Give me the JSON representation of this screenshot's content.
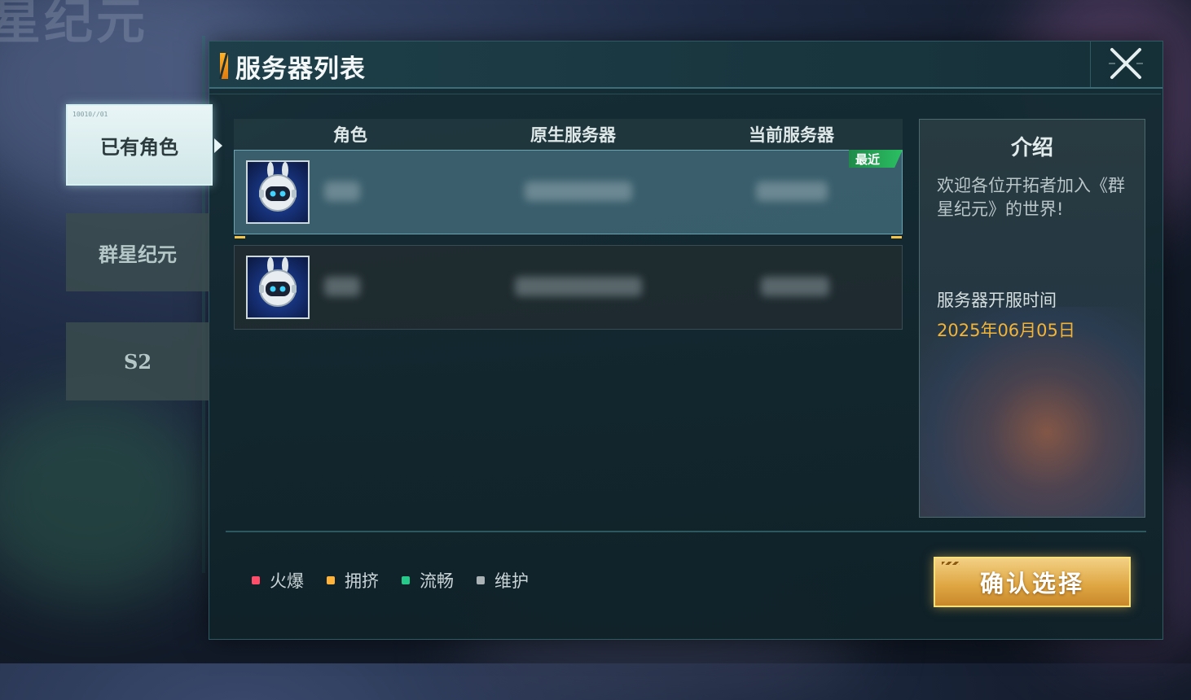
{
  "window": {
    "title": "服务器列表",
    "close_icon": "close-x-icon"
  },
  "tabs": [
    {
      "label": "已有角色",
      "tag": "10010//01",
      "active": true
    },
    {
      "label": "群星纪元",
      "active": false
    },
    {
      "label": "S2",
      "active": false
    }
  ],
  "table": {
    "headers": {
      "role": "角色",
      "origin_server": "原生服务器",
      "current_server": "当前服务器"
    },
    "rows": [
      {
        "avatar": "robot-avatar-icon",
        "recent_badge": "最近",
        "selected": true
      },
      {
        "avatar": "robot-avatar-icon",
        "selected": false
      }
    ]
  },
  "intro": {
    "title": "介绍",
    "text": "欢迎各位开拓者加入《群星纪元》的世界!",
    "open_label": "服务器开服时间",
    "open_date": "2025年06月05日"
  },
  "legend": [
    {
      "label": "火爆",
      "color": "#ff4d6a"
    },
    {
      "label": "拥挤",
      "color": "#ffb33b"
    },
    {
      "label": "流畅",
      "color": "#27c98a"
    },
    {
      "label": "维护",
      "color": "#aab2b6"
    }
  ],
  "confirm_button": {
    "label": "确认选择"
  },
  "colors": {
    "accent": "#f2b437",
    "selected_row": "#3e6472",
    "recent_badge": "#2bbf62"
  }
}
